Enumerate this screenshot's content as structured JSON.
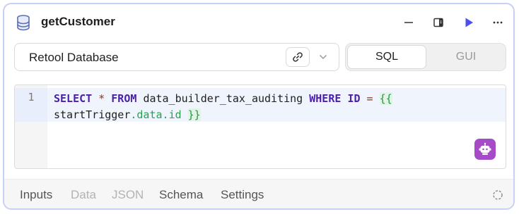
{
  "header": {
    "title": "getCustomer",
    "icons": [
      "database-icon",
      "minimize-icon",
      "panel-icon",
      "run-icon",
      "more-icon"
    ]
  },
  "resource": {
    "label": "Retool Database",
    "icons": [
      "link-icon",
      "chevron-down-icon"
    ]
  },
  "mode_toggle": {
    "options": [
      "SQL",
      "GUI"
    ],
    "selected": "SQL"
  },
  "editor": {
    "line_number": "1",
    "tokens": {
      "select": "SELECT",
      "star": "*",
      "from": "FROM",
      "table": "data_builder_tax_auditing",
      "where": "WHERE",
      "id_col": "ID",
      "eq": "=",
      "open_brace": "{{",
      "var_start": "startTrigger",
      "dot1": ".",
      "var_data": "data",
      "dot2": ".",
      "var_id": "id",
      "close_brace": "}}"
    },
    "assistant_icon": "robot-icon"
  },
  "footer": {
    "tabs": [
      "Inputs",
      "Data",
      "JSON",
      "Schema",
      "Settings"
    ],
    "enabled_tabs": [
      "Inputs",
      "Schema",
      "Settings"
    ],
    "status_icon": "loading-icon"
  },
  "colors": {
    "accent": "#4b4ff0",
    "card_border": "#c7d0f5",
    "keyword": "#4b1fa8",
    "template_brace": "#1f9a4a",
    "assistant_bg": "#a54bc7"
  }
}
